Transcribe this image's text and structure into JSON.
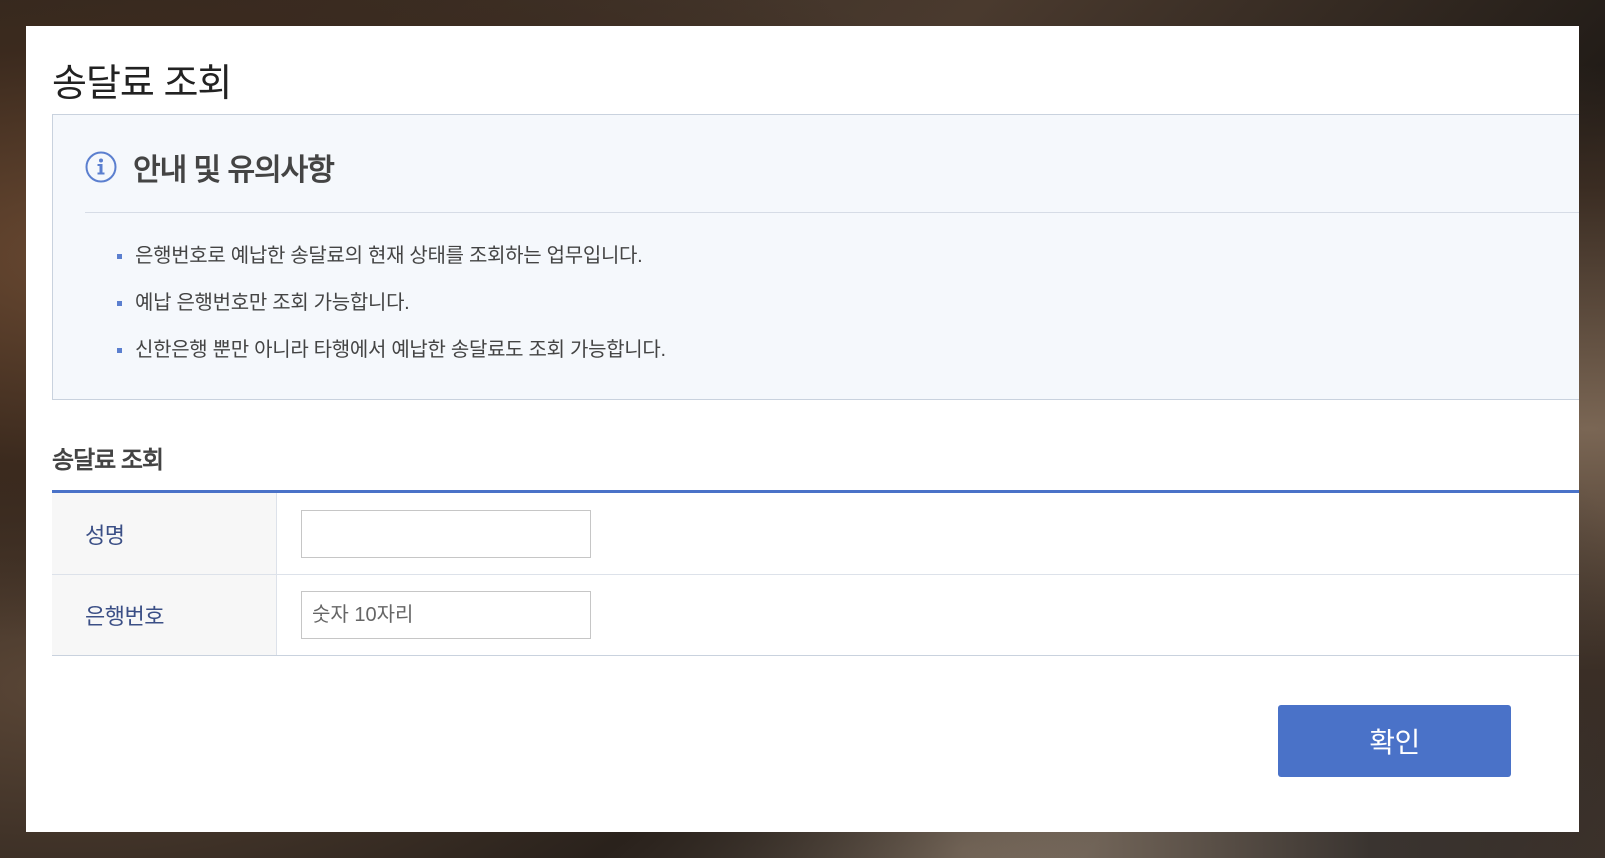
{
  "modal": {
    "title": "송달료 조회"
  },
  "notice": {
    "title": "안내 및 유의사항",
    "icon": "info-icon",
    "items": [
      "은행번호로 예납한 송달료의 현재 상태를 조회하는 업무입니다.",
      "예납 은행번호만 조회 가능합니다.",
      "신한은행 뿐만 아니라 타행에서 예납한 송달료도 조회 가능합니다."
    ]
  },
  "form": {
    "section_title": "송달료 조회",
    "name": {
      "label": "성명",
      "value": "",
      "placeholder": ""
    },
    "bank_number": {
      "label": "은행번호",
      "value": "",
      "placeholder": "숫자 10자리"
    }
  },
  "actions": {
    "confirm_label": "확인"
  },
  "colors": {
    "accent": "#4a72c8",
    "label_text": "#3b4f86",
    "notice_bg": "#f5f8fc"
  }
}
